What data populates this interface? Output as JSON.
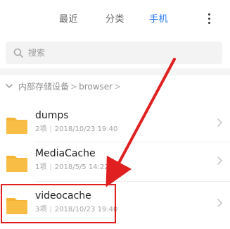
{
  "tabs": [
    {
      "label": "最近",
      "active": false
    },
    {
      "label": "分类",
      "active": false
    },
    {
      "label": "手机",
      "active": true
    }
  ],
  "search": {
    "placeholder": "搜索"
  },
  "breadcrumb": {
    "root": "内部存储设备",
    "current": "browser",
    "sep": ">"
  },
  "folders": [
    {
      "name": "dumps",
      "count": "2项",
      "date": "2018/10/23 19:40"
    },
    {
      "name": "MediaCache",
      "count": "1项",
      "date": "2018/5/5 14:22"
    },
    {
      "name": "videocache",
      "count": "3项",
      "date": "2018/10/23 19:40"
    }
  ],
  "annotation": {
    "arrow": "red-arrow",
    "highlight": "videocache"
  },
  "colors": {
    "accent": "#2f7df6",
    "folder": "#f6b436",
    "annotation": "#e02020"
  }
}
